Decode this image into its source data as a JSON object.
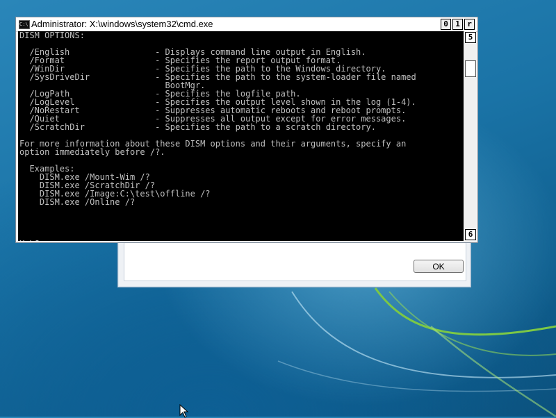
{
  "window": {
    "title": "Administrator: X:\\windows\\system32\\cmd.exe",
    "icon_label": "C:\\",
    "buttons": {
      "minimize": "0",
      "maximize": "1",
      "close": "r"
    },
    "scroll_up": "5",
    "scroll_down": "6"
  },
  "console": {
    "lines": [
      "DISM OPTIONS:",
      "",
      "  /English                 - Displays command line output in English.",
      "  /Format                  - Specifies the report output format.",
      "  /WinDir                  - Specifies the path to the Windows directory.",
      "  /SysDriveDir             - Specifies the path to the system-loader file named",
      "                             BootMgr.",
      "  /LogPath                 - Specifies the logfile path.",
      "  /LogLevel                - Specifies the output level shown in the log (1-4).",
      "  /NoRestart               - Suppresses automatic reboots and reboot prompts.",
      "  /Quiet                   - Suppresses all output except for error messages.",
      "  /ScratchDir              - Specifies the path to a scratch directory.",
      "",
      "For more information about these DISM options and their arguments, specify an",
      "option immediately before /?.",
      "",
      "  Examples:",
      "    DISM.exe /Mount-Wim /?",
      "    DISM.exe /ScratchDir /?",
      "    DISM.exe /Image:C:\\test\\offline /?",
      "    DISM.exe /Online /?",
      "",
      "",
      "",
      "",
      "X:\\Sources>"
    ]
  },
  "dialog": {
    "ok_label": "OK"
  },
  "colors": {
    "console_bg": "#000000",
    "console_text": "#c0c0c0",
    "desktop_blue": "#1a73a6"
  }
}
